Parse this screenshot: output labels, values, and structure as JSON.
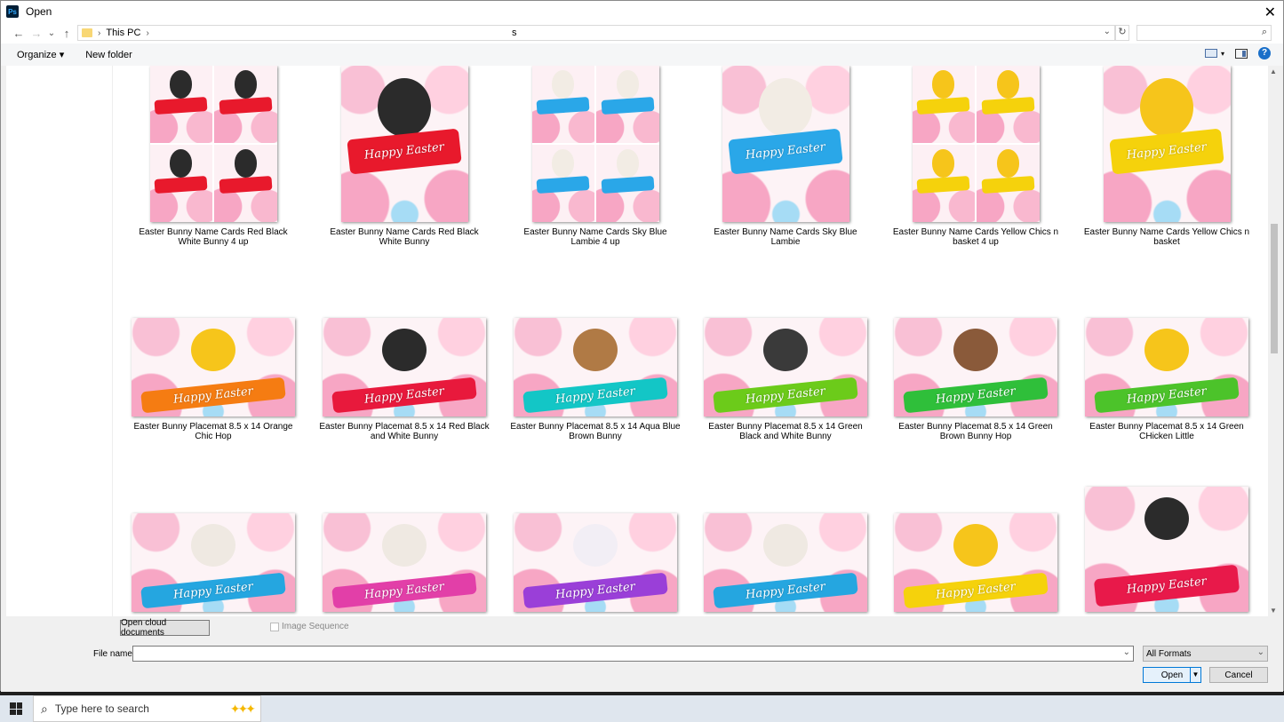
{
  "window": {
    "title": "Open",
    "app_icon": "Ps"
  },
  "nav": {
    "breadcrumb": [
      "This PC"
    ],
    "address_tail": "s"
  },
  "toolbar": {
    "organize": "Organize ▾",
    "new_folder": "New folder"
  },
  "icons": {
    "back": "←",
    "forward": "→",
    "recent": "⌄",
    "up": "↑",
    "refresh": "↻",
    "search": "⌕",
    "close": "✕",
    "help": "?"
  },
  "items": [
    {
      "label": "Easter Bunny Name Cards Red Black White Bunny 4 up",
      "shape": "portrait",
      "grid": true,
      "ribbon": "#e8192c",
      "head": "#2b2b2b",
      "caption": "Happy Easter"
    },
    {
      "label": "Easter Bunny Name Cards Red Black White Bunny",
      "shape": "portrait",
      "grid": false,
      "ribbon": "#e8192c",
      "head": "#2b2b2b",
      "caption": "Happy Easter"
    },
    {
      "label": "Easter Bunny Name Cards Sky Blue Lambie 4 up",
      "shape": "portrait",
      "grid": true,
      "ribbon": "#2aa7e8",
      "head": "#f2ece4",
      "caption": "Happy Easter"
    },
    {
      "label": "Easter Bunny Name Cards Sky Blue Lambie",
      "shape": "portrait",
      "grid": false,
      "ribbon": "#2aa7e8",
      "head": "#f2ece4",
      "caption": "Happy Easter"
    },
    {
      "label": "Easter Bunny Name Cards Yellow Chics n basket 4 up",
      "shape": "portrait",
      "grid": true,
      "ribbon": "#f5d20c",
      "head": "#f6c51b",
      "caption": "Happy Easter"
    },
    {
      "label": "Easter Bunny Name Cards Yellow Chics n basket",
      "shape": "portrait",
      "grid": false,
      "ribbon": "#f5d20c",
      "head": "#f6c51b",
      "caption": "Happy Easter"
    },
    {
      "label": "Easter Bunny Placemat  8.5 x 14  Orange Chic Hop",
      "shape": "landscape",
      "ribbon": "#f57c12",
      "head": "#f6c51b",
      "caption": "Happy Easter"
    },
    {
      "label": "Easter Bunny Placemat  8.5 x 14  Red Black and White Bunny",
      "shape": "landscape",
      "ribbon": "#e8193c",
      "head": "#2b2b2b",
      "caption": "Happy Easter"
    },
    {
      "label": "Easter Bunny Placemat  8.5 x 14 Aqua Blue Brown Bunny",
      "shape": "landscape",
      "ribbon": "#13c6c6",
      "head": "#b07a45",
      "caption": "Happy Easter"
    },
    {
      "label": "Easter Bunny Placemat  8.5 x 14 Green Black and White Bunny",
      "shape": "landscape",
      "ribbon": "#6ccb1a",
      "head": "#3a3a3a",
      "caption": "Happy Easter"
    },
    {
      "label": "Easter Bunny Placemat  8.5 x 14 Green Brown Bunny Hop",
      "shape": "landscape",
      "ribbon": "#2fbf3a",
      "head": "#8a5a3a",
      "caption": "Happy Easter"
    },
    {
      "label": "Easter Bunny Placemat  8.5 x 14 Green CHicken Little",
      "shape": "landscape",
      "ribbon": "#4cc32a",
      "head": "#f6c51b",
      "caption": "Happy Easter"
    },
    {
      "label": "",
      "shape": "landscape",
      "ribbon": "#25a6e0",
      "head": "#efe9e2",
      "caption": "Happy Easter"
    },
    {
      "label": "",
      "shape": "landscape",
      "ribbon": "#e23fa8",
      "head": "#efe9e2",
      "caption": "Happy Easter"
    },
    {
      "label": "",
      "shape": "landscape",
      "ribbon": "#9a3fd8",
      "head": "#f2eef5",
      "caption": "Happy Easter"
    },
    {
      "label": "",
      "shape": "landscape",
      "ribbon": "#25a6e0",
      "head": "#efe9e2",
      "caption": "Happy Easter"
    },
    {
      "label": "",
      "shape": "landscape",
      "ribbon": "#f5d20c",
      "head": "#f6c51b",
      "caption": "Happy Easter"
    },
    {
      "label": "",
      "shape": "tall",
      "ribbon": "#e8194a",
      "head": "#2b2b2b",
      "caption": "Happy Easter"
    }
  ],
  "bottom": {
    "cloud_button": "Open cloud documents",
    "image_sequence": "Image Sequence",
    "file_name_label": "File name:",
    "file_name_value": "",
    "format": "All Formats",
    "open": "Open",
    "cancel": "Cancel"
  },
  "taskbar": {
    "search_placeholder": "Type here to search"
  }
}
